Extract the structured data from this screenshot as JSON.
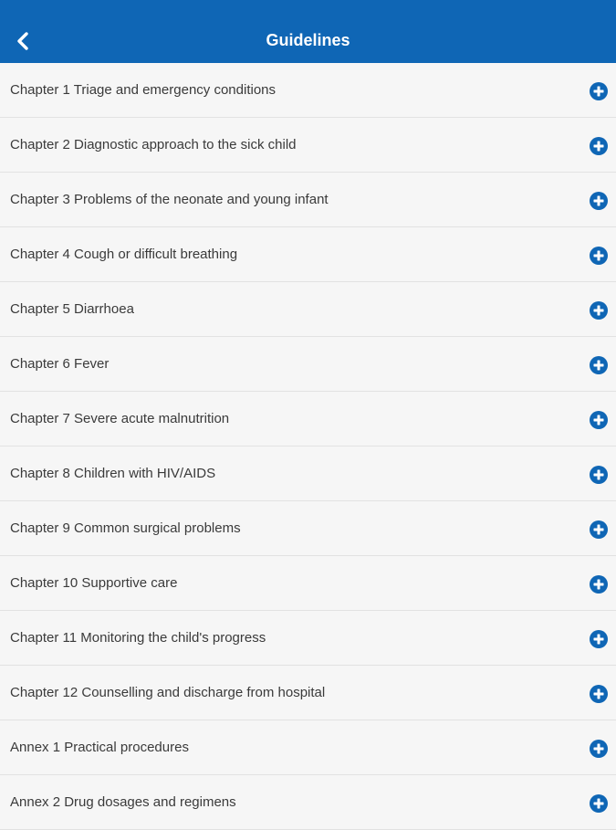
{
  "header": {
    "title": "Guidelines",
    "back_icon": "chevron-left-icon"
  },
  "colors": {
    "header_bg": "#0f66b5",
    "accent": "#0f66b5",
    "row_bg": "#f6f6f6",
    "divider": "#e2e2e2",
    "text": "#3a3a3a"
  },
  "items": [
    {
      "label": "Chapter 1 Triage and emergency conditions",
      "icon": "plus-circle-icon"
    },
    {
      "label": "Chapter 2 Diagnostic approach to the sick child",
      "icon": "plus-circle-icon"
    },
    {
      "label": "Chapter 3 Problems of the neonate and young infant",
      "icon": "plus-circle-icon"
    },
    {
      "label": "Chapter 4 Cough or difficult breathing",
      "icon": "plus-circle-icon"
    },
    {
      "label": "Chapter 5 Diarrhoea",
      "icon": "plus-circle-icon"
    },
    {
      "label": "Chapter 6 Fever",
      "icon": "plus-circle-icon"
    },
    {
      "label": "Chapter 7 Severe acute malnutrition",
      "icon": "plus-circle-icon"
    },
    {
      "label": "Chapter 8 Children with HIV/AIDS",
      "icon": "plus-circle-icon"
    },
    {
      "label": "Chapter 9 Common surgical problems",
      "icon": "plus-circle-icon"
    },
    {
      "label": "Chapter 10 Supportive care",
      "icon": "plus-circle-icon"
    },
    {
      "label": "Chapter 11 Monitoring the child's progress",
      "icon": "plus-circle-icon"
    },
    {
      "label": "Chapter 12 Counselling and discharge from hospital",
      "icon": "plus-circle-icon"
    },
    {
      "label": "Annex 1 Practical procedures",
      "icon": "plus-circle-icon"
    },
    {
      "label": "Annex 2 Drug dosages and regimens",
      "icon": "plus-circle-icon"
    }
  ]
}
